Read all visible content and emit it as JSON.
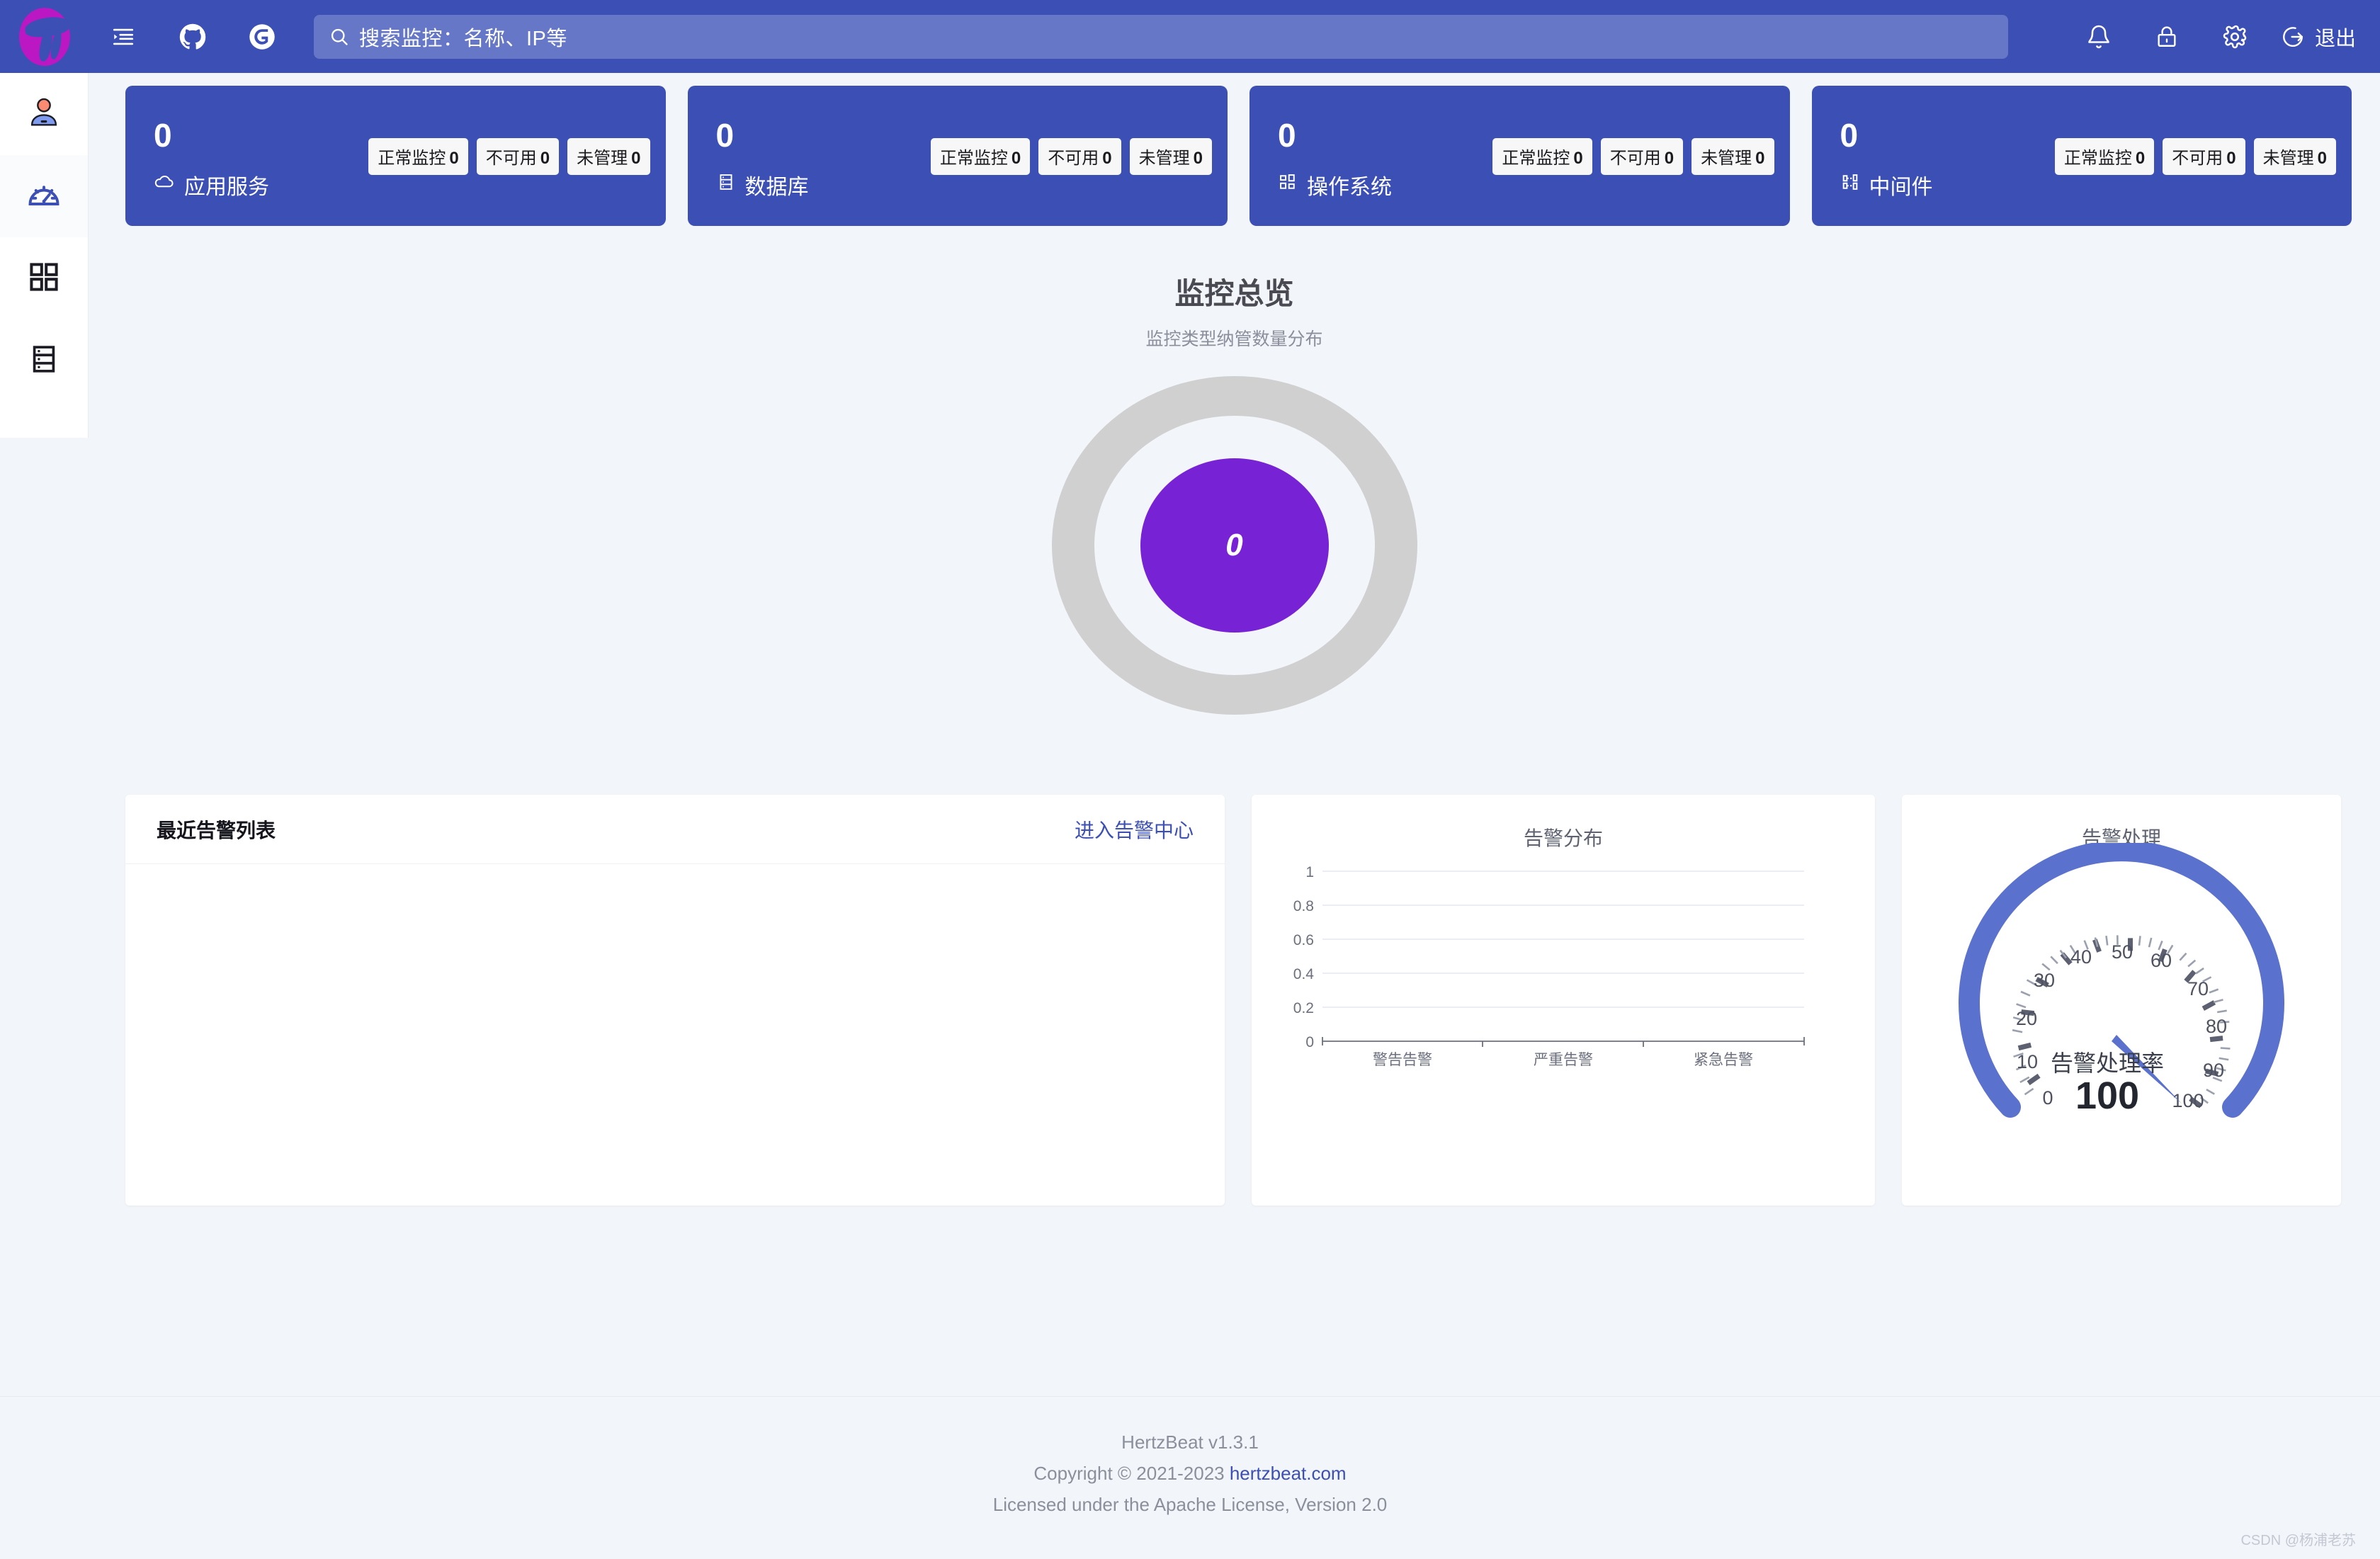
{
  "header": {
    "logo_icon": "hertzbeat-logo-icon",
    "menu_toggle_icon": "menu-fold-icon",
    "github_icon": "github-icon",
    "gitee_icon": "gitee-icon",
    "search": {
      "placeholder": "搜索监控：名称、IP等",
      "value": "",
      "icon": "search-icon"
    },
    "bell_icon": "bell-icon",
    "lock_icon": "lock-icon",
    "gear_icon": "gear-icon",
    "logout_icon": "logout-icon",
    "logout_label": "退出"
  },
  "sidebar": {
    "items": [
      {
        "name": "account-avatar",
        "icon": "user-avatar-icon",
        "active": false
      },
      {
        "name": "dashboard",
        "icon": "dashboard-gauge-icon",
        "active": true
      },
      {
        "name": "monitors",
        "icon": "grid-apps-icon",
        "active": false
      },
      {
        "name": "alerts",
        "icon": "server-list-icon",
        "active": false
      }
    ]
  },
  "stat_cards": [
    {
      "count": "0",
      "label": "应用服务",
      "icon": "cloud-icon",
      "badges": [
        {
          "label": "正常监控",
          "value": "0"
        },
        {
          "label": "不可用",
          "value": "0"
        },
        {
          "label": "未管理",
          "value": "0"
        }
      ]
    },
    {
      "count": "0",
      "label": "数据库",
      "icon": "database-icon",
      "badges": [
        {
          "label": "正常监控",
          "value": "0"
        },
        {
          "label": "不可用",
          "value": "0"
        },
        {
          "label": "未管理",
          "value": "0"
        }
      ]
    },
    {
      "count": "0",
      "label": "操作系统",
      "icon": "os-windows-icon",
      "badges": [
        {
          "label": "正常监控",
          "value": "0"
        },
        {
          "label": "不可用",
          "value": "0"
        },
        {
          "label": "未管理",
          "value": "0"
        }
      ]
    },
    {
      "count": "0",
      "label": "中间件",
      "icon": "middleware-icon",
      "badges": [
        {
          "label": "正常监控",
          "value": "0"
        },
        {
          "label": "不可用",
          "value": "0"
        },
        {
          "label": "未管理",
          "value": "0"
        }
      ]
    }
  ],
  "overview": {
    "title": "监控总览",
    "subtitle": "监控类型纳管数量分布",
    "center_value": "0"
  },
  "alerts_panel": {
    "title": "最近告警列表",
    "link_label": "进入告警中心",
    "rows": []
  },
  "colors": {
    "brand_indigo": "#3b4fb5",
    "search_field": "#6577c6",
    "logo_magenta": "#bb18c4",
    "donut_core_purple": "#7722d4",
    "donut_ring_gray": "#d0d0d0",
    "page_bg": "#f2f5f9",
    "gauge_arc": "#5a71cd"
  },
  "chart_data": [
    {
      "type": "bar",
      "title": "告警分布",
      "categories": [
        "警告告警",
        "严重告警",
        "紧急告警"
      ],
      "values": [
        0,
        0,
        0
      ],
      "xlabel": "",
      "ylabel": "",
      "ylim": [
        0,
        1
      ],
      "yticks": [
        "0",
        "0.2",
        "0.4",
        "0.6",
        "0.8",
        "1"
      ],
      "grid": true,
      "legend": "none"
    },
    {
      "type": "gauge",
      "title": "告警处理",
      "label": "告警处理率",
      "value": 100,
      "min": 0,
      "max": 100,
      "ticks": [
        "0",
        "10",
        "20",
        "30",
        "40",
        "50",
        "60",
        "70",
        "80",
        "90",
        "100"
      ],
      "unit": ""
    }
  ],
  "footer": {
    "version": "HertzBeat v1.3.1",
    "copyright_prefix": "Copyright © 2021-2023 ",
    "copyright_link": "hertzbeat.com",
    "license": "Licensed under the Apache License, Version 2.0"
  },
  "watermark": "CSDN @杨浦老苏"
}
